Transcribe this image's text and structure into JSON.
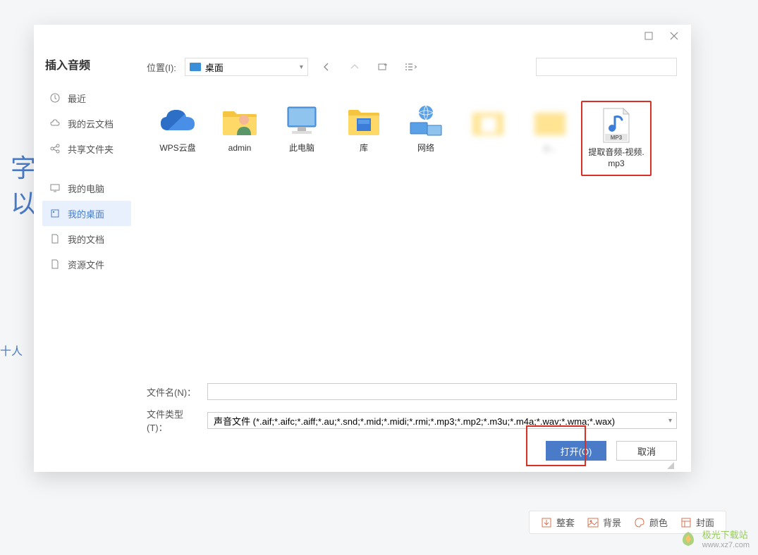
{
  "bg": {
    "line1": "字",
    "line2": "以",
    "line3": "十人"
  },
  "dialog": {
    "title": "插入音频",
    "location_label": "位置(I):",
    "location_value": "桌面",
    "search_placeholder": "",
    "file_name_label": "文件名(N)：",
    "file_name_value": "",
    "file_type_label": "文件类型(T)：",
    "file_type_value": "声音文件 (*.aif;*.aifc;*.aiff;*.au;*.snd;*.mid;*.midi;*.rmi;*.mp3;*.mp2;*.m3u;*.m4a;*.wav;*.wma;*.wax)",
    "open_btn": "打开(O)",
    "cancel_btn": "取消"
  },
  "sidebar": {
    "items": [
      {
        "label": "最近",
        "icon": "clock"
      },
      {
        "label": "我的云文档",
        "icon": "cloud"
      },
      {
        "label": "共享文件夹",
        "icon": "share"
      },
      {
        "label": "我的电脑",
        "icon": "monitor"
      },
      {
        "label": "我的桌面",
        "icon": "desktop"
      },
      {
        "label": "我的文档",
        "icon": "doc"
      },
      {
        "label": "资源文件",
        "icon": "doc"
      }
    ]
  },
  "files": [
    {
      "label": "WPS云盘",
      "type": "cloud"
    },
    {
      "label": "admin",
      "type": "user"
    },
    {
      "label": "此电脑",
      "type": "pc"
    },
    {
      "label": "库",
      "type": "library"
    },
    {
      "label": "网络",
      "type": "network"
    },
    {
      "label": "",
      "type": "blurred"
    },
    {
      "label": "z...",
      "type": "blurred"
    },
    {
      "label": "提取音频-视频.mp3",
      "type": "mp3"
    }
  ],
  "bottom_bar": {
    "items": [
      {
        "label": "整套",
        "icon": "download"
      },
      {
        "label": "背景",
        "icon": "image"
      },
      {
        "label": "颜色",
        "icon": "palette"
      },
      {
        "label": "封面",
        "icon": "template"
      }
    ]
  },
  "watermark": {
    "text": "极光下载站",
    "url": "www.xz7.com"
  }
}
